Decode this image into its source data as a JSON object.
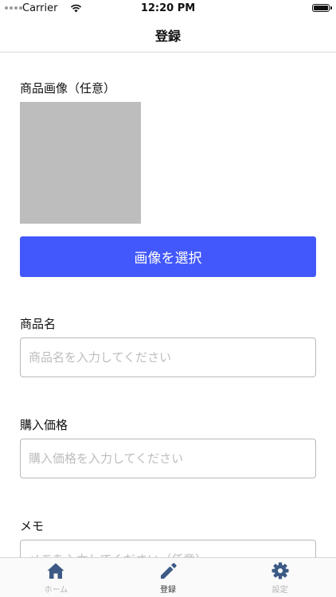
{
  "status_bar": {
    "carrier": "Carrier",
    "time": "12:20 PM"
  },
  "nav": {
    "title": "登録"
  },
  "form": {
    "image_label": "商品画像（任意）",
    "select_image_button": "画像を選択",
    "name_label": "商品名",
    "name_placeholder": "商品名を入力してください",
    "price_label": "購入価格",
    "price_placeholder": "購入価格を入力してください",
    "memo_label": "メモ",
    "memo_placeholder": "メモを入力してください（任意）"
  },
  "tab_bar": {
    "tabs": [
      {
        "label": "ホーム",
        "icon": "home-icon",
        "active": false
      },
      {
        "label": "登録",
        "icon": "pencil-icon",
        "active": true
      },
      {
        "label": "設定",
        "icon": "gear-icon",
        "active": false
      }
    ]
  },
  "colors": {
    "accent": "#4258fb",
    "tab_icon": "#3d5a86",
    "placeholder_box": "#bdbdbd"
  }
}
